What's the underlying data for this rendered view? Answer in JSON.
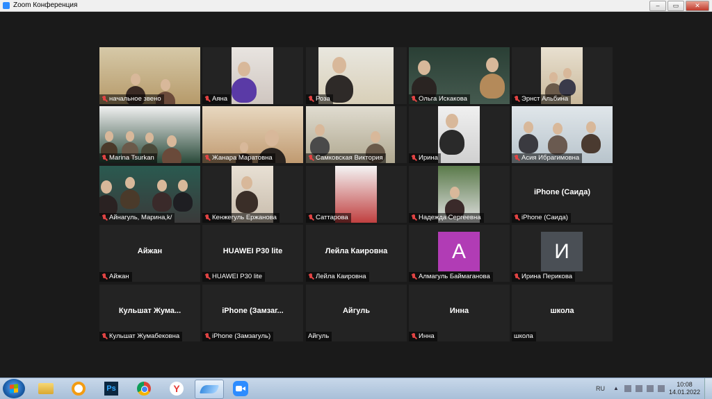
{
  "window": {
    "title": "Zoom Конференция"
  },
  "participants": [
    {
      "name": "начальное звено",
      "center": "",
      "type": "video"
    },
    {
      "name": "Аяна",
      "center": "",
      "type": "video"
    },
    {
      "name": "Роза",
      "center": "",
      "type": "video"
    },
    {
      "name": "Ольга Искакова",
      "center": "",
      "type": "video"
    },
    {
      "name": "Эрнст Альбина",
      "center": "",
      "type": "video"
    },
    {
      "name": "Marina Tsurkan",
      "center": "",
      "type": "video"
    },
    {
      "name": "Жанара Маратовна",
      "center": "",
      "type": "video"
    },
    {
      "name": "Самковская Виктория",
      "center": "",
      "type": "video"
    },
    {
      "name": "Ирина",
      "center": "",
      "type": "video"
    },
    {
      "name": "Асия Ибрагимовна",
      "center": "",
      "type": "video"
    },
    {
      "name": "Айнагуль, Марина,k/",
      "center": "",
      "type": "video"
    },
    {
      "name": "Кенжегуль Ержанова",
      "center": "",
      "type": "video"
    },
    {
      "name": "Саттарова",
      "center": "",
      "type": "video"
    },
    {
      "name": "Надежда Сергеевна",
      "center": "",
      "type": "video"
    },
    {
      "name": "iPhone (Саида)",
      "center": "iPhone (Саида)",
      "type": "text"
    },
    {
      "name": "Айжан",
      "center": "Айжан",
      "type": "text"
    },
    {
      "name": "HUAWEI P30 lite",
      "center": "HUAWEI P30 lite",
      "type": "text"
    },
    {
      "name": "Лейла Каировна",
      "center": "Лейла Каировна",
      "type": "text"
    },
    {
      "name": "Алмагуль Баймаганова",
      "center": "A",
      "type": "avatar",
      "color": "#b13cb5"
    },
    {
      "name": "Ирина Перикова",
      "center": "И",
      "type": "avatar",
      "color": "#4a4f55"
    },
    {
      "name": "Кульшат Жумабековна",
      "center": "Кульшат Жума...",
      "type": "text"
    },
    {
      "name": "iPhone (Замзагуль)",
      "center": "iPhone (Замзаг...",
      "type": "text"
    },
    {
      "name": "Айгуль",
      "center": "Айгуль",
      "type": "text",
      "unmuted": true
    },
    {
      "name": "Инна",
      "center": "Инна",
      "type": "text"
    },
    {
      "name": "школа",
      "center": "школа",
      "type": "text",
      "unmuted": true
    }
  ],
  "taskbar": {
    "apps": [
      "start-button",
      "file-explorer",
      "browser-orange",
      "photoshop",
      "chrome",
      "yandex-browser",
      "app-active",
      "zoom"
    ],
    "language": "RU",
    "time": "10:08",
    "date": "14.01.2022"
  }
}
